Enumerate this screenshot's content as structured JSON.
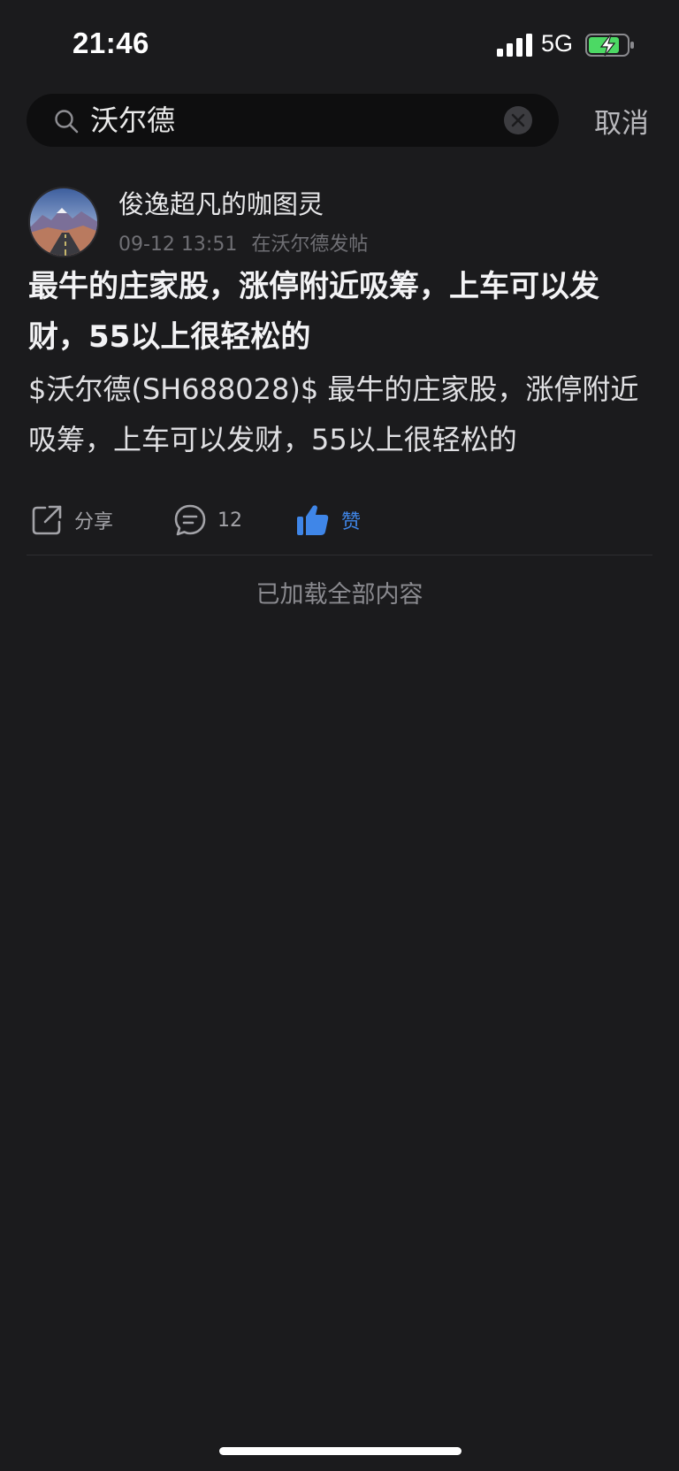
{
  "status_bar": {
    "time": "21:46",
    "network": "5G",
    "battery_icon": "battery-charging-icon",
    "signal_icon": "signal-bars-icon"
  },
  "search": {
    "query": "沃尔德",
    "placeholder": "",
    "cancel_label": "取消"
  },
  "post": {
    "author": "俊逸超凡的咖图灵",
    "timestamp": "09-12 13:51",
    "source": "在沃尔德发帖",
    "title": "最牛的庄家股，涨停附近吸筹，上车可以发财，55以上很轻松的",
    "content": "$沃尔德(SH688028)$ 最牛的庄家股，涨停附近吸筹，上车可以发财，55以上很轻松的",
    "actions": {
      "share_label": "分享",
      "comment_count": "12",
      "like_label": "赞"
    }
  },
  "footer": {
    "end_note": "已加载全部内容"
  },
  "colors": {
    "background": "#1b1b1d",
    "search_field": "#0e0e0f",
    "like_accent": "#3f86e8",
    "battery_green": "#4cd964"
  }
}
